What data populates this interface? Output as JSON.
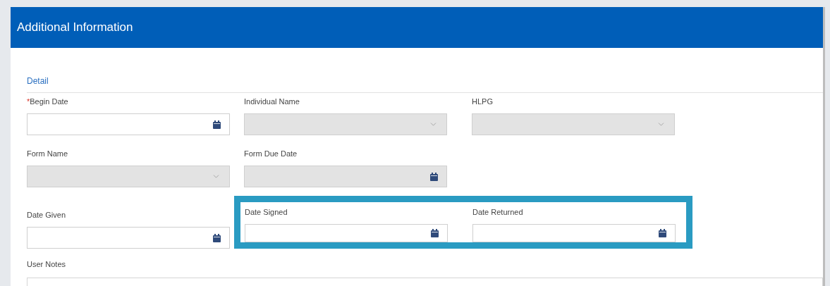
{
  "panel": {
    "title": "Additional Information"
  },
  "section": {
    "title": "Detail"
  },
  "rows": [
    [
      {
        "label": "Begin Date",
        "required_mark": "*",
        "kind": "date",
        "disabled": false,
        "highlighted": false
      },
      {
        "label": "Individual Name",
        "kind": "select",
        "disabled": true,
        "highlighted": false
      },
      {
        "label": "HLPG",
        "kind": "select",
        "disabled": true,
        "highlighted": false
      }
    ],
    [
      {
        "label": "Form Name",
        "kind": "select",
        "disabled": true,
        "highlighted": false
      },
      {
        "label": "Form Due Date",
        "kind": "date",
        "disabled": true,
        "highlighted": false
      }
    ],
    [
      {
        "label": "Date Given",
        "kind": "date",
        "disabled": false,
        "highlighted": false
      },
      {
        "label": "Date Signed",
        "kind": "date",
        "disabled": false,
        "highlighted": true
      },
      {
        "label": "Date Returned",
        "kind": "date",
        "disabled": false,
        "highlighted": true
      }
    ]
  ],
  "notes": {
    "label": "User Notes"
  }
}
